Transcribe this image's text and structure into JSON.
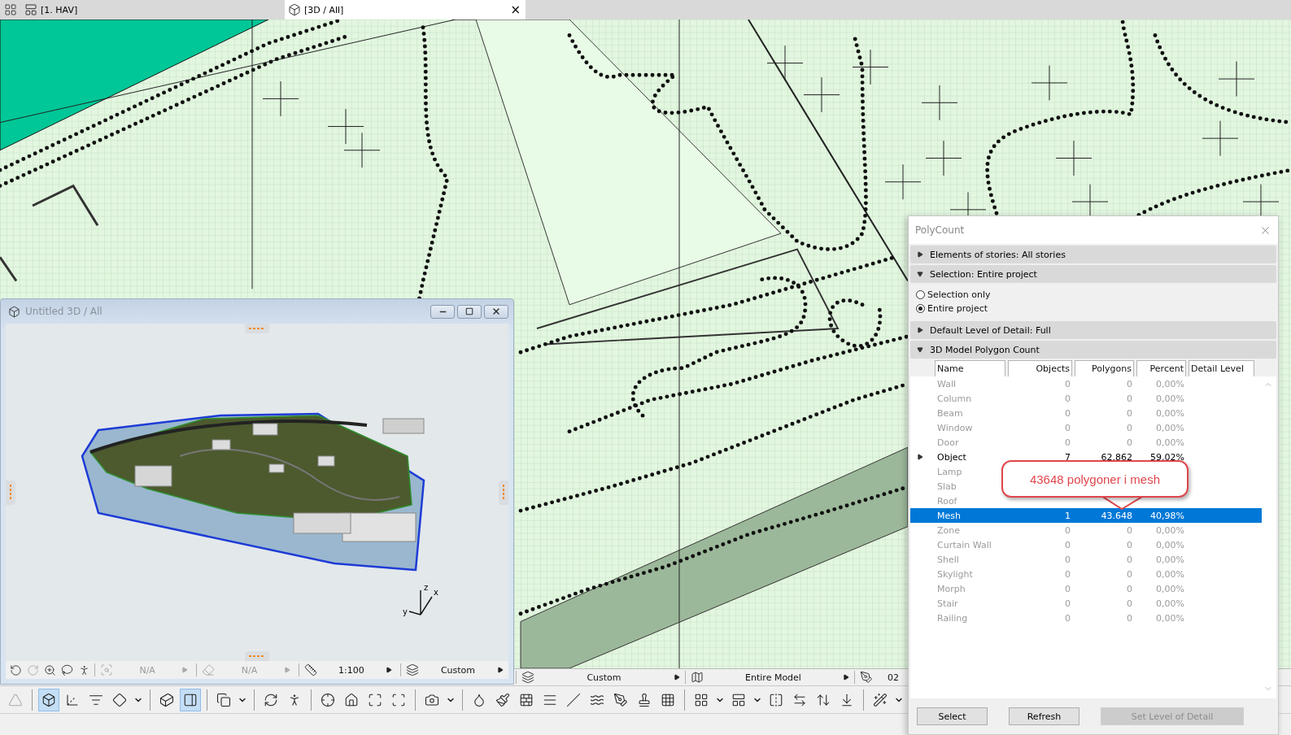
{
  "tabs": [
    {
      "kind": "plan",
      "label": "[1. HAV]",
      "selected": false
    },
    {
      "kind": "model3d",
      "label": "[3D / All]",
      "selected": true,
      "close": "×"
    }
  ],
  "plan_status": [
    {
      "kind": "layers",
      "text": "Custom"
    },
    {
      "kind": "model",
      "text": "Entire Model"
    },
    {
      "kind": "pen",
      "text": "02"
    }
  ],
  "toolbar": [
    {
      "kind": "up",
      "on": false
    },
    {
      "kind": "sep"
    },
    {
      "kind": "cube-frame",
      "on": true
    },
    {
      "kind": "axes",
      "on": false
    },
    {
      "kind": "house-filter",
      "on": false
    },
    {
      "kind": "plane",
      "on": false
    },
    {
      "kind": "caret"
    },
    {
      "kind": "sep"
    },
    {
      "kind": "cube",
      "on": false
    },
    {
      "kind": "cube-side",
      "on": true
    },
    {
      "kind": "sep"
    },
    {
      "kind": "layer-list",
      "on": false
    },
    {
      "kind": "caret"
    },
    {
      "kind": "sep"
    },
    {
      "kind": "orbit",
      "on": false
    },
    {
      "kind": "walk",
      "on": false
    },
    {
      "kind": "sep"
    },
    {
      "kind": "target",
      "on": false
    },
    {
      "kind": "house-frame",
      "on": false
    },
    {
      "kind": "house-arrows",
      "on": false
    },
    {
      "kind": "survey",
      "on": false
    },
    {
      "kind": "sep"
    },
    {
      "kind": "camera",
      "on": false
    },
    {
      "kind": "caret"
    },
    {
      "kind": "sep"
    },
    {
      "kind": "drop",
      "on": false
    },
    {
      "kind": "brush",
      "on": false
    },
    {
      "kind": "bricks",
      "on": false
    },
    {
      "kind": "hatch",
      "on": false
    },
    {
      "kind": "slope",
      "on": false
    },
    {
      "kind": "water",
      "on": false
    },
    {
      "kind": "pen",
      "on": false
    },
    {
      "kind": "stamp",
      "on": false
    },
    {
      "kind": "hatch-grid",
      "on": false
    },
    {
      "kind": "sep"
    },
    {
      "kind": "grid-axes",
      "on": false
    },
    {
      "kind": "caret"
    },
    {
      "kind": "grid-select",
      "on": false
    },
    {
      "kind": "caret"
    },
    {
      "kind": "flip",
      "on": false
    },
    {
      "kind": "swap",
      "on": false
    },
    {
      "kind": "level",
      "on": false
    },
    {
      "kind": "level-down",
      "on": false
    },
    {
      "kind": "sep"
    },
    {
      "kind": "wand",
      "on": false
    },
    {
      "kind": "caret"
    }
  ],
  "view3d": {
    "title": "Untitled 3D / All",
    "axis_labels": [
      "x",
      "y",
      "z"
    ],
    "status": [
      {
        "kind": "zoom",
        "text": "N/A",
        "disabled": true
      },
      {
        "kind": "eraser",
        "text": "N/A",
        "disabled": true
      },
      {
        "kind": "scale",
        "text": "1:100",
        "disabled": false
      },
      {
        "kind": "layers",
        "text": "Custom",
        "disabled": false
      }
    ]
  },
  "polycount": {
    "title": "PolyCount",
    "sections": [
      {
        "label": "Elements of stories: All stories",
        "expanded": false
      },
      {
        "label": "Selection: Entire project",
        "expanded": true,
        "options": [
          {
            "label": "Selection only",
            "selected": false
          },
          {
            "label": "Entire project",
            "selected": true
          }
        ]
      },
      {
        "label": "Default Level of Detail: Full",
        "expanded": false
      },
      {
        "label": "3D Model Polygon Count",
        "expanded": true
      }
    ],
    "table": {
      "columns": [
        "Name",
        "Objects",
        "Polygons",
        "Percent",
        "Detail Level"
      ],
      "rows": [
        {
          "name": "Wall",
          "objects": "0",
          "polygons": "0",
          "percent": "0,00%",
          "active": false,
          "selected": false
        },
        {
          "name": "Column",
          "objects": "0",
          "polygons": "0",
          "percent": "0,00%",
          "active": false,
          "selected": false
        },
        {
          "name": "Beam",
          "objects": "0",
          "polygons": "0",
          "percent": "0,00%",
          "active": false,
          "selected": false
        },
        {
          "name": "Window",
          "objects": "0",
          "polygons": "0",
          "percent": "0,00%",
          "active": false,
          "selected": false
        },
        {
          "name": "Door",
          "objects": "0",
          "polygons": "0",
          "percent": "0,00%",
          "active": false,
          "selected": false
        },
        {
          "name": "Object",
          "objects": "7",
          "polygons": "62.862",
          "percent": "59,02%",
          "active": true,
          "selected": false,
          "expandable": true
        },
        {
          "name": "Lamp",
          "active": false,
          "selected": false
        },
        {
          "name": "Slab",
          "active": false,
          "selected": false
        },
        {
          "name": "Roof",
          "active": false,
          "selected": false
        },
        {
          "name": "Mesh",
          "objects": "1",
          "polygons": "43.648",
          "percent": "40,98%",
          "active": true,
          "selected": true
        },
        {
          "name": "Zone",
          "objects": "0",
          "polygons": "0",
          "percent": "0,00%",
          "active": false,
          "selected": false
        },
        {
          "name": "Curtain Wall",
          "objects": "0",
          "polygons": "0",
          "percent": "0,00%",
          "active": false,
          "selected": false
        },
        {
          "name": "Shell",
          "objects": "0",
          "polygons": "0",
          "percent": "0,00%",
          "active": false,
          "selected": false
        },
        {
          "name": "Skylight",
          "objects": "0",
          "polygons": "0",
          "percent": "0,00%",
          "active": false,
          "selected": false
        },
        {
          "name": "Morph",
          "objects": "0",
          "polygons": "0",
          "percent": "0,00%",
          "active": false,
          "selected": false
        },
        {
          "name": "Stair",
          "objects": "0",
          "polygons": "0",
          "percent": "0,00%",
          "active": false,
          "selected": false
        },
        {
          "name": "Railing",
          "objects": "0",
          "polygons": "0",
          "percent": "0,00%",
          "active": false,
          "selected": false
        }
      ]
    },
    "callout": "43648 polygoner i mesh",
    "buttons": [
      {
        "label": "Select",
        "disabled": false
      },
      {
        "label": "Refresh",
        "disabled": false
      },
      {
        "label": "Set Level of Detail",
        "disabled": true
      }
    ]
  }
}
